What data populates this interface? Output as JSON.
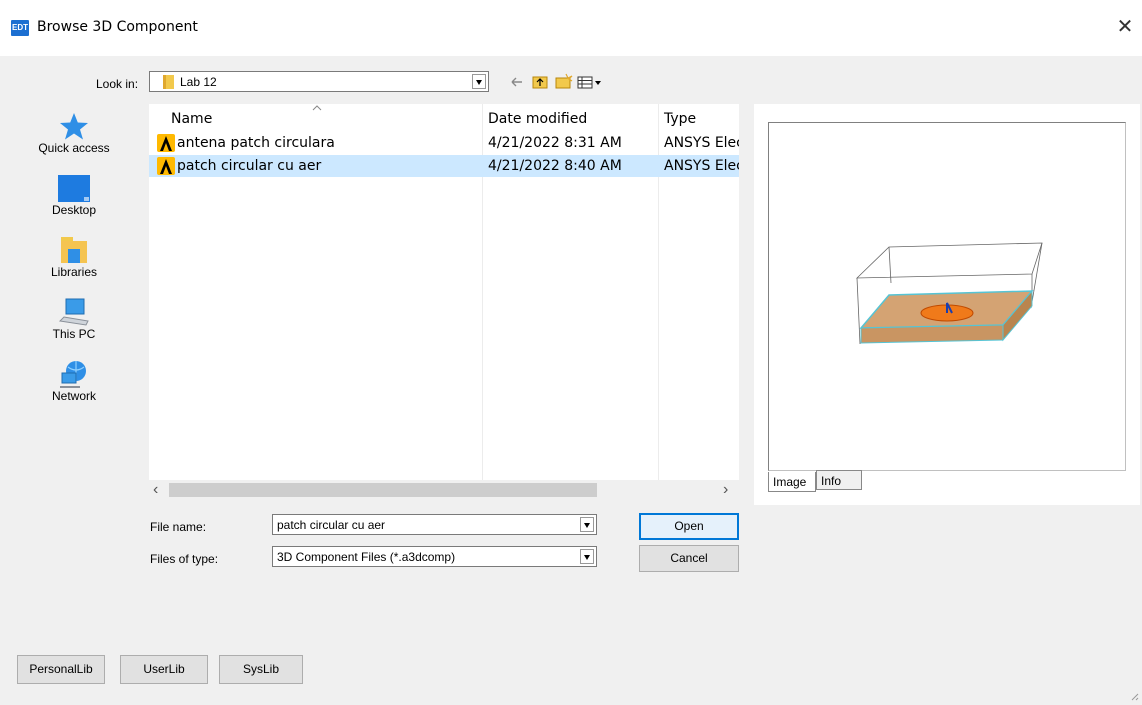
{
  "window": {
    "app_icon_text": "EDT",
    "title": "Browse 3D Component",
    "close_glyph": "✕"
  },
  "lookin": {
    "label": "Look in:",
    "value": "Lab 12"
  },
  "places": [
    {
      "label": "Quick access",
      "icon": "star-icon"
    },
    {
      "label": "Desktop",
      "icon": "desktop-icon"
    },
    {
      "label": "Libraries",
      "icon": "libraries-icon"
    },
    {
      "label": "This PC",
      "icon": "computer-icon"
    },
    {
      "label": "Network",
      "icon": "network-icon"
    }
  ],
  "columns": [
    "Name",
    "Date modified",
    "Type"
  ],
  "files": [
    {
      "name": "antena patch circulara",
      "date": "4/21/2022 8:31 AM",
      "type": "ANSYS Elec",
      "selected": false
    },
    {
      "name": "patch circular cu aer",
      "date": "4/21/2022 8:40 AM",
      "type": "ANSYS Elec",
      "selected": true
    }
  ],
  "scroll": {
    "left": "‹",
    "right": "›"
  },
  "filename": {
    "label": "File name:",
    "value": "patch circular cu aer"
  },
  "filetype": {
    "label": "Files of type:",
    "value": "3D Component Files (*.a3dcomp)"
  },
  "buttons": {
    "open": "Open",
    "cancel": "Cancel"
  },
  "preview_tabs": {
    "image": "Image",
    "info": "Info"
  },
  "lib_buttons": {
    "personal": "PersonalLib",
    "user": "UserLib",
    "sys": "SysLib"
  },
  "colors": {
    "selection": "#cce8ff",
    "accent": "#0078d7",
    "substrate": "#d4a373",
    "patch": "#f07a1a",
    "edge": "#56c4d4"
  }
}
